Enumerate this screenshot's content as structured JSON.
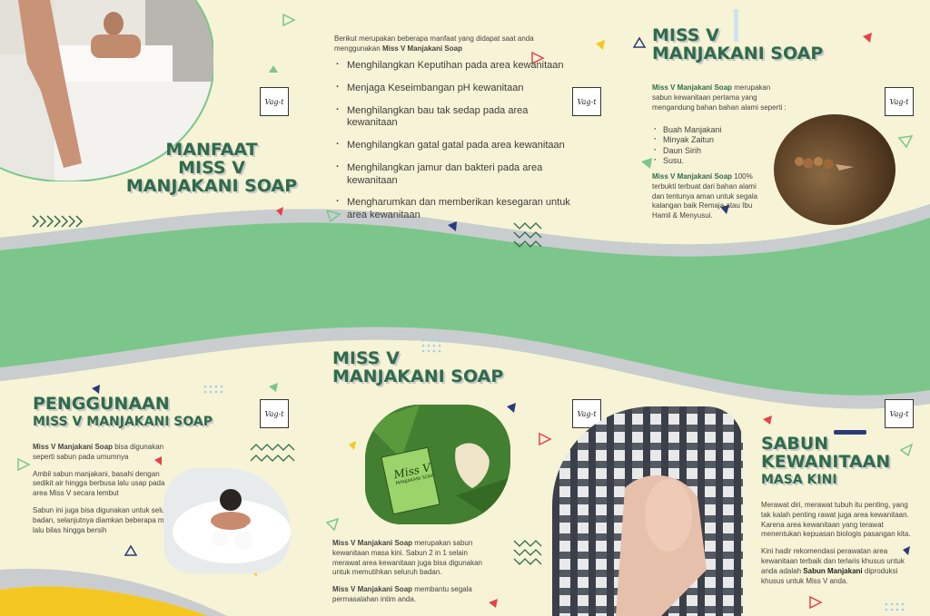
{
  "brand": {
    "logo_text": "Vag-t"
  },
  "colors": {
    "green_band": "#7cc68b",
    "heading_green": "#2f6b4a",
    "background": "#f7f3d6",
    "accent_red": "#e2444d",
    "accent_yellow": "#f5c723",
    "accent_navy": "#2b3a7a"
  },
  "panel_manfaat": {
    "heading_line1": "MANFAAT",
    "heading_line2": "MISS V",
    "heading_line3": "MANJAKANI SOAP",
    "intro_text": "Berikut merupakan beberapa manfaat yang didapat saat anda menggunakan",
    "intro_product": "Miss V Manjakani Soap",
    "benefits": [
      "Menghilangkan Keputihan pada area kewanitaan",
      "Menjaga Keseimbangan pH kewanitaan",
      "Menghilangkan bau tak sedap pada area kewanitaan",
      "Menghilangkan gatal gatal pada area kewanitaan",
      "Menghilangkan jamur dan bakteri pada area kewanitaan",
      "Mengharumkan dan memberikan kesegaran untuk area kewanitaan"
    ]
  },
  "panel_about": {
    "heading_line1": "MISS V",
    "heading_line2": "MANJAKANI SOAP",
    "desc_product": "Miss V Manjakani Soap",
    "desc_text": "merupakan sabun kewanitaan pertama yang mengandung bahan bahan alami seperti :",
    "ingredients": [
      "Buah Manjakani",
      "Minyak Zaitun",
      "Daun Sirih",
      "Susu."
    ],
    "closing_product": "Miss V Manjakani Soap",
    "closing_text": "100% terbukti terbuat dari bahan alami dan tentunya aman untuk segala kalangan baik Remaja atau Ibu Hamil & Menyusui."
  },
  "panel_usage": {
    "heading_line1": "PENGGUNAAN",
    "heading_line2": "MISS V MANJAKANI SOAP",
    "p1_product": "Miss V Manjakani Soap",
    "p1_text": "bisa digunakan seperti sabun pada umumnya",
    "p2": "Ambil sabun manjakani, basahi dengan sedikit air hingga berbusa lalu usap pada area Miss V secara lembut",
    "p3": "Sabun ini juga bisa digunakan untuk seluruh badan, selanjutnya diamkan beberapa menit lalu bilas hingga bersih"
  },
  "panel_center": {
    "heading_line1": "MISS V",
    "heading_line2": "MANJAKANI SOAP",
    "box_brand": "Miss V",
    "box_sub": "MANJAKANI SOAP",
    "p1_product": "Miss V Manjakani Soap",
    "p1_text": "merupakan sabun kewanitaan masa kini. Sabun 2 in 1 selain merawat area kewanitaan juga bisa digunakan untuk memutihkan seluruh badan.",
    "p2_product": "Miss V Manjakani Soap",
    "p2_text": "membantu segala permasalahan intim anda."
  },
  "panel_masa_kini": {
    "heading_line1": "SABUN",
    "heading_line2": "KEWANITAAN",
    "heading_line3": "MASA KINI",
    "p1": "Merawat diri, merawat tubuh itu penting, yang tak kalah penting rawat juga area kewanitaan. Karena area kewanitaan yang terawat menentukan kepuasan biologis pasangan kita.",
    "p2_text": "Kini hadir rekomendasi perawatan area kewanitaan terbaik dan terlaris khusus untuk anda adalah",
    "p2_product": "Sabun Manjakani",
    "p2_tail": "diproduksi khusus untuk Miss V anda."
  }
}
